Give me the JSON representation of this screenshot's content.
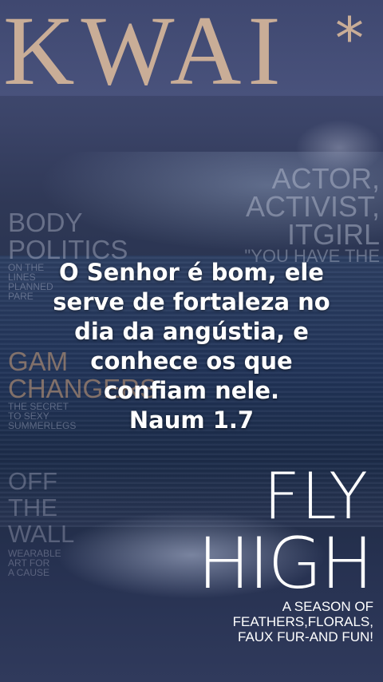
{
  "cover": {
    "logo": "KWAI",
    "logo_mark": "*",
    "actor_lines": [
      "ACTOR,",
      "ACTIVIST,",
      "ITGIRL"
    ],
    "actor_quote": "\"YOU HAVE THE",
    "body_politics": [
      "BODY",
      "POLITICS"
    ],
    "body_small": [
      "ON THE",
      "LINES",
      "PLANNED",
      "PARE"
    ],
    "game_changers": [
      "GAM",
      "CHANGERS"
    ],
    "game_small": [
      "THE SECRET",
      "TO SEXY",
      "SUMMERLEGS"
    ],
    "off_the_wall": [
      "OFF",
      "THE",
      "WALL"
    ],
    "wall_small": [
      "WEARABLE",
      "ART FOR",
      "A CAUSE"
    ],
    "fly": "FLY",
    "high": "HIGH",
    "season_lines": [
      "A SEASON OF",
      "FEATHERS,FLORALS,",
      "FAUX FUR-AND FUN!"
    ]
  },
  "overlay": {
    "lines": [
      "O Senhor é bom, ele",
      "serve de fortaleza no",
      "dia da angústia, e",
      "conhece os que",
      "confiam nele.",
      "Naum 1.7"
    ]
  },
  "colors": {
    "logo": "#c9ad97",
    "overlay_text": "#ffffff",
    "background": "#2a3552"
  }
}
